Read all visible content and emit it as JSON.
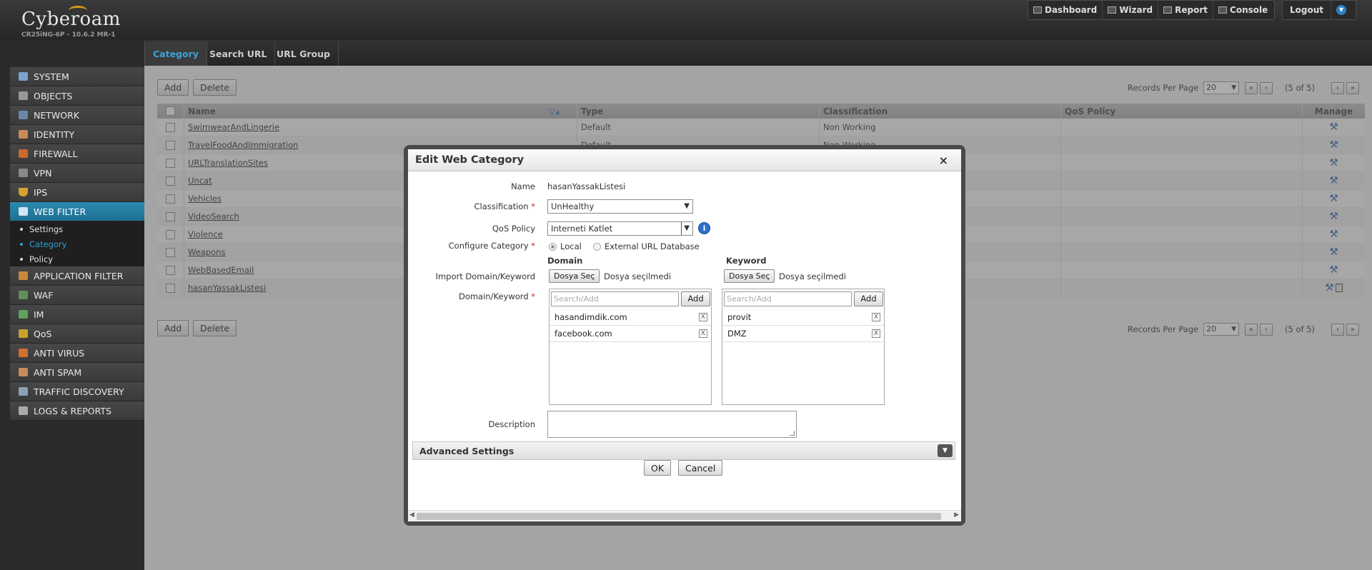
{
  "app": {
    "brand": "Cyberoam",
    "version": "CR25iNG-6P - 10.6.2 MR-1"
  },
  "top_buttons": {
    "dashboard": "Dashboard",
    "wizard": "Wizard",
    "report": "Report",
    "console": "Console",
    "logout": "Logout"
  },
  "sidebar": {
    "items": [
      {
        "label": "SYSTEM"
      },
      {
        "label": "OBJECTS"
      },
      {
        "label": "NETWORK"
      },
      {
        "label": "IDENTITY"
      },
      {
        "label": "FIREWALL"
      },
      {
        "label": "VPN"
      },
      {
        "label": "IPS"
      },
      {
        "label": "WEB FILTER"
      }
    ],
    "sub_items": [
      {
        "label": "Settings"
      },
      {
        "label": "Category"
      },
      {
        "label": "Policy"
      }
    ],
    "items_after": [
      {
        "label": "APPLICATION FILTER"
      },
      {
        "label": "WAF"
      },
      {
        "label": "IM"
      },
      {
        "label": "QoS"
      },
      {
        "label": "ANTI VIRUS"
      },
      {
        "label": "ANTI SPAM"
      },
      {
        "label": "TRAFFIC DISCOVERY"
      },
      {
        "label": "LOGS & REPORTS"
      }
    ]
  },
  "tabs": [
    {
      "label": "Category"
    },
    {
      "label": "Search URL"
    },
    {
      "label": "URL Group"
    }
  ],
  "toolbar": {
    "add": "Add",
    "delete": "Delete",
    "records_per_page": "Records Per Page",
    "rpp_value": "20",
    "page_count": "(5 of 5)"
  },
  "table": {
    "headers": {
      "name": "Name",
      "type": "Type",
      "classification": "Classification",
      "qos": "QoS Policy",
      "manage": "Manage"
    },
    "rows": [
      {
        "name": "SwimwearAndLingerie",
        "type": "Default",
        "classification": "Non Working"
      },
      {
        "name": "TravelFoodAndImmigration",
        "type": "Default",
        "classification": "Non Working"
      },
      {
        "name": "URLTranslationSites",
        "type": "",
        "classification": ""
      },
      {
        "name": "Uncat",
        "type": "",
        "classification": ""
      },
      {
        "name": "Vehicles",
        "type": "",
        "classification": ""
      },
      {
        "name": "VideoSearch",
        "type": "",
        "classification": ""
      },
      {
        "name": "Violence",
        "type": "",
        "classification": ""
      },
      {
        "name": "Weapons",
        "type": "",
        "classification": ""
      },
      {
        "name": "WebBasedEmail",
        "type": "",
        "classification": ""
      },
      {
        "name": "hasanYassakListesi",
        "type": "",
        "classification": ""
      }
    ]
  },
  "modal": {
    "title": "Edit Web Category",
    "close": "×",
    "name_label": "Name",
    "name_value": "hasanYassakListesi",
    "classification_label": "Classification",
    "classification_value": "UnHealthy",
    "qos_label": "QoS Policy",
    "qos_value": "Interneti Katlet",
    "info": "i",
    "configure_label": "Configure Category",
    "local": "Local",
    "external": "External URL Database",
    "domain_header": "Domain",
    "keyword_header": "Keyword",
    "import_label": "Import Domain/Keyword",
    "file_button": "Dosya Seç",
    "file_none": "Dosya seçilmedi",
    "dk_label": "Domain/Keyword",
    "search_placeholder": "Search/Add",
    "add": "Add",
    "domains": [
      "hasandimdik.com",
      "facebook.com"
    ],
    "keywords": [
      "provit",
      "DMZ"
    ],
    "description_label": "Description",
    "advanced": "Advanced Settings",
    "ok": "OK",
    "cancel": "Cancel",
    "remove": "X"
  }
}
